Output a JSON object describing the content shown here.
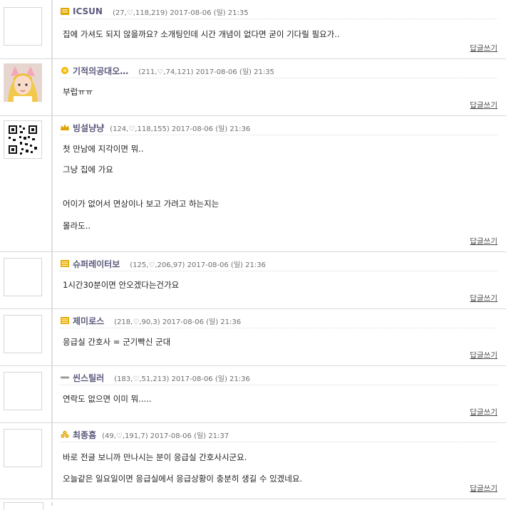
{
  "reply_label": "답글쓰기",
  "colors": {
    "nick": "#5b5a7c",
    "meta": "#6f6f6f",
    "divider": "#d9d9d9"
  },
  "comments": [
    {
      "nick": "ICSUN",
      "level_icon": "book-level-icon",
      "meta": "(27,♡,118,219) 2017-08-06 (일) 21:35",
      "avatar": "empty",
      "lines": [
        "집에 가셔도 되지 않을까요? 소개팅인데 시간 개념이 없다면 굳이 기다릴 필요가.."
      ]
    },
    {
      "nick": "기적의공대오…",
      "level_icon": "sun-level-icon",
      "meta": "(211,♡,74,121) 2017-08-06 (일) 21:35",
      "avatar": "photo",
      "lines": [
        "부럽ㅠㅠ"
      ]
    },
    {
      "nick": "빙설냥냥",
      "level_icon": "crown-level-icon",
      "meta": "(124,♡,118,155) 2017-08-06 (일) 21:36",
      "avatar": "qr",
      "lines": [
        "첫 만남에 지각이면 뭐..",
        "그냥 집에 가요",
        "",
        "어이가 없어서 면상이나 보고 가려고 하는지는",
        "몰라도.."
      ]
    },
    {
      "nick": "슈퍼레이터보",
      "level_icon": "box-level-icon",
      "meta": "(125,♡,206,97) 2017-08-06 (일) 21:36",
      "avatar": "empty",
      "lines": [
        "1시간30분이면 안오겠다는건가요"
      ]
    },
    {
      "nick": "제미로스",
      "level_icon": "box-level-icon",
      "meta": "(218,♡,90,3) 2017-08-06 (일) 21:36",
      "avatar": "empty",
      "lines": [
        "응급실 간호사 = 군기빡신 군대"
      ]
    },
    {
      "nick": "씬스틸러",
      "level_icon": "bar-level-icon",
      "meta": "(183,♡,51,213) 2017-08-06 (일) 21:36",
      "avatar": "empty",
      "lines": [
        "연락도 없으면 이미 뭐....."
      ]
    },
    {
      "nick": "최종흠",
      "level_icon": "pile-level-icon",
      "meta": "(49,♡,191,7) 2017-08-06 (일) 21:37",
      "avatar": "empty",
      "lines": [
        "바로 전글 보니까 만나시는 분이 응급실 간호사시군요.",
        "오늘같은 일요일이면 응급실에서 응급상황이 충분히 생길 수 있겠네요."
      ]
    }
  ]
}
